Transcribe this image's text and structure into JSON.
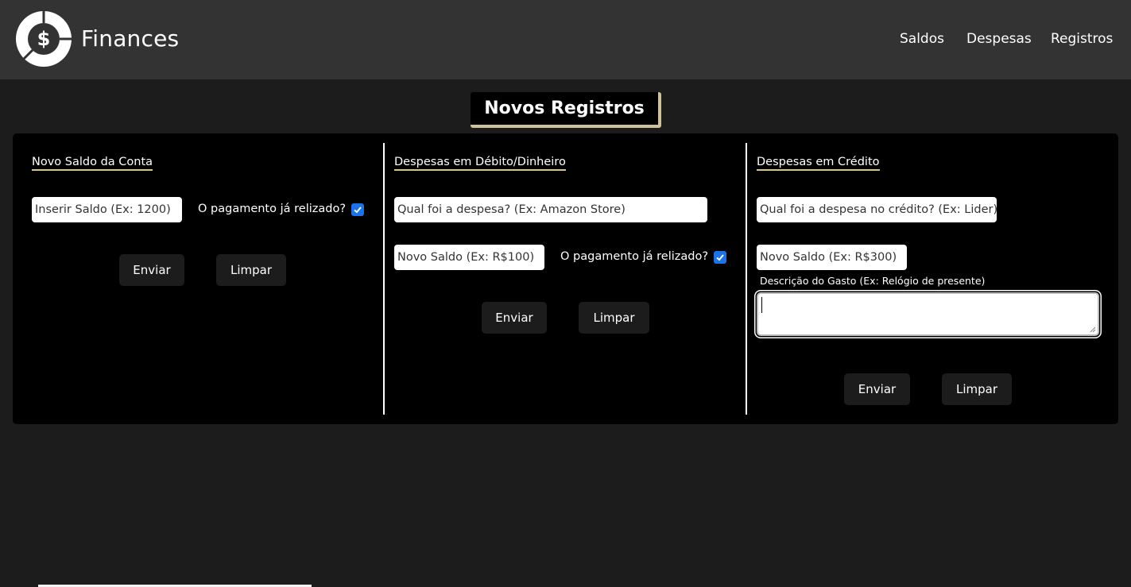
{
  "header": {
    "brand": "Finances",
    "logo_icon": "dollar-pie-icon",
    "nav": [
      "Saldos",
      "Despesas",
      "Registros"
    ]
  },
  "page_title": "Novos Registros",
  "sections": {
    "saldo": {
      "title": "Novo Saldo da Conta",
      "input_placeholder": "Inserir Saldo (Ex: 1200)",
      "checkbox_label": "O pagamento já relizado?",
      "checked": true,
      "submit_label": "Enviar",
      "clear_label": "Limpar"
    },
    "debito": {
      "title": "Despesas em Débito/Dinheiro",
      "expense_placeholder": "Qual foi a despesa? (Ex: Amazon Store)",
      "saldo_placeholder": "Novo Saldo (Ex: R$100)",
      "checkbox_label": "O pagamento já relizado?",
      "checked": true,
      "submit_label": "Enviar",
      "clear_label": "Limpar"
    },
    "credito": {
      "title": "Despesas em Crédito",
      "expense_placeholder": "Qual foi a despesa no crédito? (Ex: Lider)",
      "saldo_placeholder": "Novo Saldo (Ex: R$300)",
      "description_label": "Descrição do Gasto (Ex: Relógio de presente)",
      "description_value": "",
      "submit_label": "Enviar",
      "clear_label": "Limpar"
    }
  },
  "colors": {
    "header_bg": "#333334",
    "page_bg": "#1c1c1c",
    "panel_bg": "#000000",
    "accent_underline": "#d8c77f",
    "title_shadow": "#cfc19a",
    "checkbox": "#1a73e8"
  }
}
